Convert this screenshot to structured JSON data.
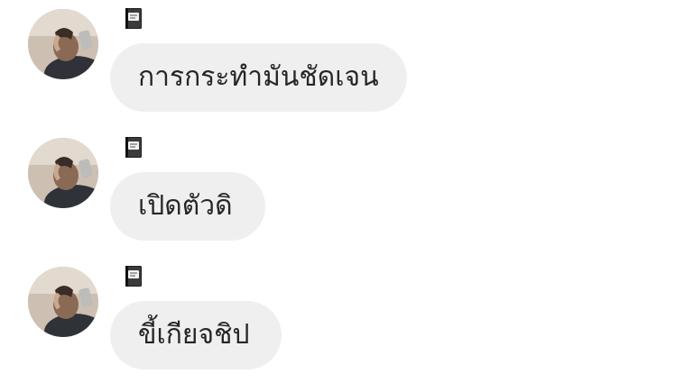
{
  "colors": {
    "bubble_background": "#efefef",
    "text": "#262626",
    "page_background": "#ffffff"
  },
  "messages": [
    {
      "sender_icon": "notebook-icon",
      "text": "การกระทำมันชัดเจน"
    },
    {
      "sender_icon": "notebook-icon",
      "text": "เปิดตัวดิ"
    },
    {
      "sender_icon": "notebook-icon",
      "text": "ขี้เกียจชิป"
    }
  ]
}
